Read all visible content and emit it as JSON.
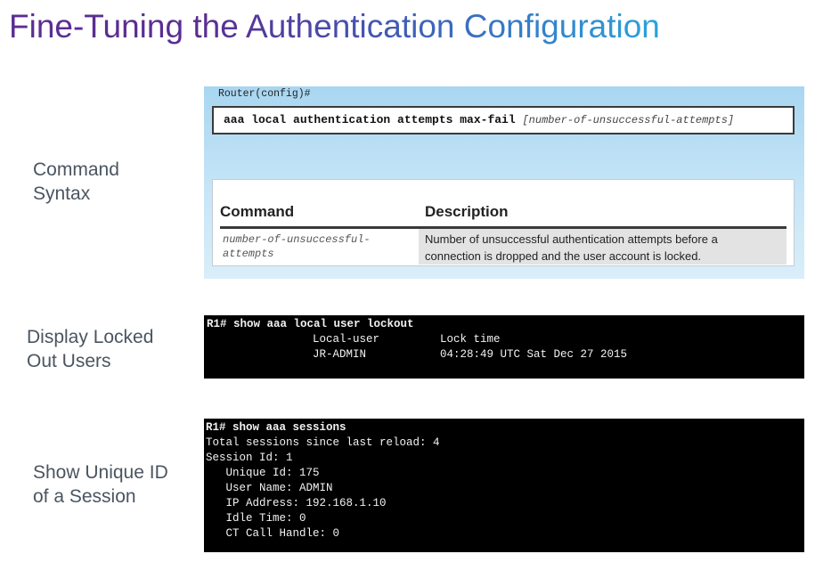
{
  "title": "Fine-Tuning the Authentication Configuration",
  "labels": {
    "command_syntax": [
      "Command",
      "Syntax"
    ],
    "display_locked": [
      "Display Locked",
      "Out Users"
    ],
    "show_unique": [
      "Show Unique ID",
      "of a Session"
    ]
  },
  "syntax": {
    "prompt": "Router(config)#",
    "command": "aaa local authentication attempts max-fail",
    "argument": "[number-of-unsuccessful-attempts]"
  },
  "table": {
    "headers": [
      "Command",
      "Description"
    ],
    "rows": [
      {
        "command": "number-of-unsuccessful-attempts",
        "command_lines": [
          "number-of-unsuccessful-",
          "attempts"
        ],
        "description_lines": [
          "Number of unsuccessful authentication attempts before a",
          "connection is dropped and the user account is locked."
        ]
      }
    ]
  },
  "lockout": {
    "command": "R1# show aaa local user lockout",
    "col_headers": [
      "Local-user",
      "Lock time"
    ],
    "row": [
      "JR-ADMIN",
      "04:28:49 UTC Sat Dec 27 2015"
    ]
  },
  "sessions": {
    "command": "R1# show aaa sessions",
    "lines": [
      "Total sessions since last reload: 4",
      "Session Id: 1",
      "   Unique Id: 175",
      "   User Name: ADMIN",
      "   IP Address: 192.168.1.10",
      "   Idle Time: 0",
      "   CT Call Handle: 0"
    ]
  }
}
